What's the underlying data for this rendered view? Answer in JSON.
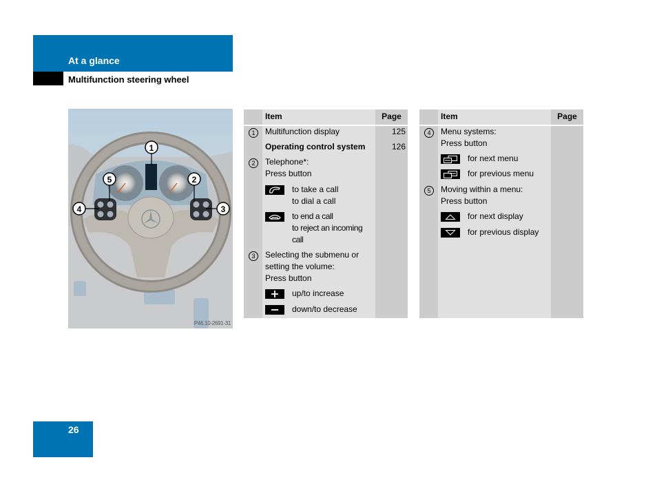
{
  "header": {
    "section_title": "At a glance",
    "subsection_title": "Multifunction steering wheel",
    "brand_color": "#0073b3"
  },
  "illustration": {
    "description": "Steering wheel with multifunction buttons",
    "callouts": [
      "1",
      "2",
      "3",
      "4",
      "5"
    ],
    "figure_code": "P46.10-2691-31"
  },
  "table_left": {
    "headers": {
      "item": "Item",
      "page": "Page"
    },
    "rows": [
      {
        "num": "1",
        "text": "Multifunction display",
        "page": "125"
      },
      {
        "num": "",
        "text": "Operating control system",
        "page": "126",
        "bold": true
      },
      {
        "num": "2",
        "text_lines": [
          "Telephone*:",
          "Press button"
        ]
      },
      {
        "icon": "phone-accept-icon",
        "text_lines": [
          "to take a call",
          "to dial a call"
        ]
      },
      {
        "icon": "phone-hangup-icon",
        "text_lines": [
          "to end a call",
          "to reject an incoming",
          "call"
        ]
      },
      {
        "num": "3",
        "text_lines": [
          "Selecting the submenu or",
          "setting the volume:",
          "Press button"
        ]
      },
      {
        "icon": "plus-icon",
        "text": "up/to increase"
      },
      {
        "icon": "minus-icon",
        "text": "down/to decrease"
      }
    ]
  },
  "table_right": {
    "headers": {
      "item": "Item",
      "page": "Page"
    },
    "rows": [
      {
        "num": "4",
        "text_lines": [
          "Menu systems:",
          "Press button"
        ]
      },
      {
        "icon": "next-menu-icon",
        "text": "for next menu"
      },
      {
        "icon": "previous-menu-icon",
        "text": "for previous menu"
      },
      {
        "num": "5",
        "text_lines": [
          "Moving within a menu:",
          "Press button"
        ]
      },
      {
        "icon": "up-arrow-icon",
        "text": "for next display"
      },
      {
        "icon": "down-arrow-icon",
        "text": "for previous display"
      }
    ]
  },
  "footer": {
    "page_number": "26"
  }
}
